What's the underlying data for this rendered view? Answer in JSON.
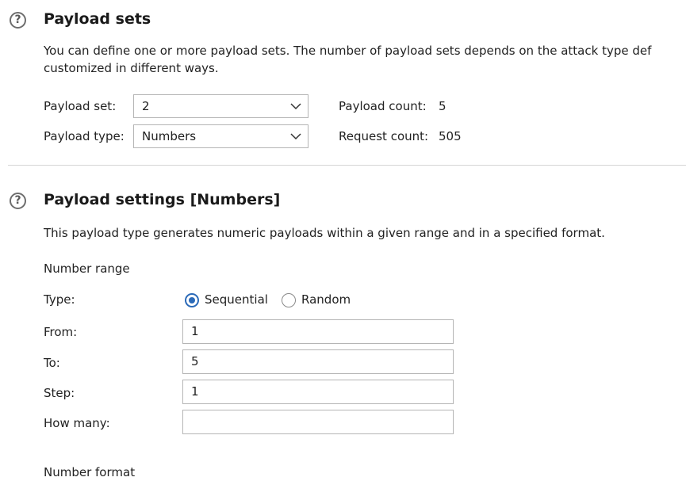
{
  "payload_sets": {
    "help_icon": "question-circle-icon",
    "title": "Payload sets",
    "description_line1": "You can define one or more payload sets. The number of payload sets depends on the attack type def",
    "description_line2": "customized in different ways.",
    "payload_set_label": "Payload set:",
    "payload_set_value": "2",
    "payload_type_label": "Payload type:",
    "payload_type_value": "Numbers",
    "payload_count_label": "Payload count:",
    "payload_count_value": "5",
    "request_count_label": "Request count:",
    "request_count_value": "505"
  },
  "payload_settings": {
    "help_icon": "question-circle-icon",
    "title": "Payload settings [Numbers]",
    "description": "This payload type generates numeric payloads within a given range and in a specified format.",
    "number_range_heading": "Number range",
    "type_label": "Type:",
    "type_options": [
      {
        "label": "Sequential",
        "selected": true
      },
      {
        "label": "Random",
        "selected": false
      }
    ],
    "from_label": "From:",
    "from_value": "1",
    "to_label": "To:",
    "to_value": "5",
    "step_label": "Step:",
    "step_value": "1",
    "how_many_label": "How many:",
    "how_many_value": "",
    "number_format_heading": "Number format"
  },
  "colors": {
    "accent": "#2b6ab8",
    "border": "#b5b5b5",
    "divider": "#d6d6d6"
  }
}
